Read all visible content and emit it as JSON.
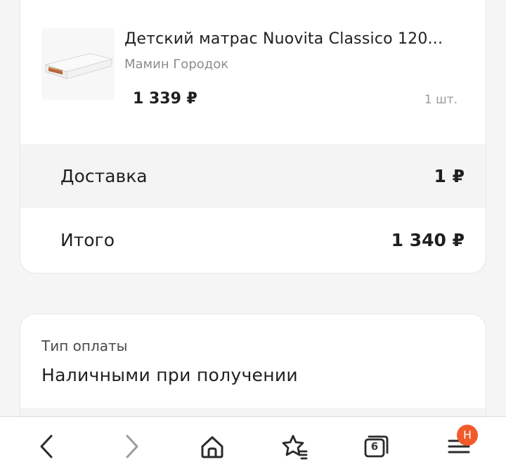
{
  "order": {
    "product": {
      "name": "Детский матрас Nuovita Classico 120...",
      "seller": "Мамин Городок",
      "price": "1 339 ₽",
      "quantity": "1 шт.",
      "image_icon": "mattress-thumbnail"
    },
    "delivery": {
      "label": "Доставка",
      "value": "1 ₽"
    },
    "total": {
      "label": "Итого",
      "value": "1 340 ₽"
    }
  },
  "payment": {
    "label": "Тип оплаты",
    "value": "Наличными при получении"
  },
  "browser_bar": {
    "back_icon": "chevron-left-icon",
    "forward_icon": "chevron-right-icon",
    "home_icon": "home-icon",
    "bookmarks_icon": "star-list-icon",
    "tabs_count": "6",
    "menu_icon": "hamburger-menu-icon",
    "menu_badge": "H",
    "badge_color": "#f25a2a"
  }
}
